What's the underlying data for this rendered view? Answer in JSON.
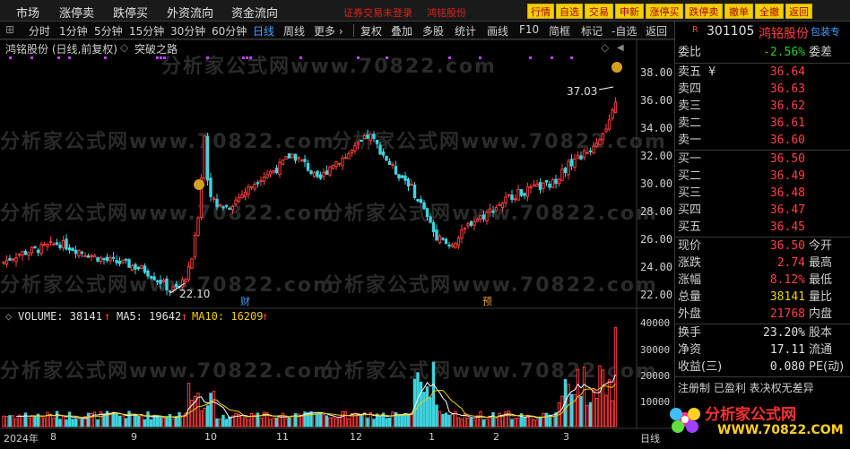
{
  "menu": {
    "items": [
      "市场",
      "涨停卖",
      "跌停买",
      "外资流向",
      "资金流向"
    ],
    "warning": "证券交易未登录",
    "stock_name": "鸿铭股份",
    "quick": [
      "行情",
      "自选",
      "交易",
      "申新",
      "涨停买",
      "跌停卖",
      "撤单",
      "全撤",
      "返回"
    ]
  },
  "toolbar": {
    "periods": [
      "分时",
      "1分钟",
      "5分钟",
      "15分钟",
      "30分钟",
      "60分钟",
      "日线",
      "周线",
      "更多 ›"
    ],
    "active_period": "日线",
    "tools": [
      "复权",
      "叠加",
      "多股",
      "统计",
      "画线",
      "F10",
      "简框",
      "标记",
      "-自选",
      "返回"
    ]
  },
  "chart_title": {
    "name": "鸿铭股份 (日线,前复权)",
    "indicator": "突破之路"
  },
  "price_axis": [
    "38.00",
    "36.00",
    "34.00",
    "32.00",
    "30.00",
    "28.00",
    "26.00",
    "24.00",
    "22.00"
  ],
  "annotations": {
    "high_label": "37.03",
    "low_label": "22.10",
    "fin_marker": "财",
    "fore_marker": "预"
  },
  "volume_legend": {
    "volume": "VOLUME: 38141",
    "ma5": "MA5: 19642",
    "ma10": "MA10: 16209",
    "arrow": "↑"
  },
  "volume_axis": [
    "40000",
    "30000",
    "20000",
    "10000"
  ],
  "time_axis": [
    "2024年",
    "8",
    "9",
    "10",
    "11",
    "12",
    "1",
    "2",
    "3"
  ],
  "bottom_tab": "日线",
  "panel": {
    "code": "301105",
    "name": "鸿铭股份",
    "badge": "包装专",
    "r_marker": "R",
    "weibi_label": "委比",
    "weibi_value": "-2.56%",
    "weicha_label": "委差",
    "asks": [
      {
        "label": "卖五",
        "extra": "¥",
        "price": "36.64"
      },
      {
        "label": "卖四",
        "extra": "",
        "price": "36.63"
      },
      {
        "label": "卖三",
        "extra": "",
        "price": "36.62"
      },
      {
        "label": "卖二",
        "extra": "",
        "price": "36.61"
      },
      {
        "label": "卖一",
        "extra": "",
        "price": "36.60"
      }
    ],
    "bids": [
      {
        "label": "买一",
        "price": "36.50"
      },
      {
        "label": "买二",
        "price": "36.49"
      },
      {
        "label": "买三",
        "price": "36.48"
      },
      {
        "label": "买四",
        "price": "36.47"
      },
      {
        "label": "买五",
        "price": "36.45"
      }
    ],
    "stats": [
      {
        "label": "现价",
        "value": "36.50",
        "color": "red",
        "label2": "今开"
      },
      {
        "label": "涨跌",
        "value": "2.74",
        "color": "red",
        "label2": "最高"
      },
      {
        "label": "涨幅",
        "value": "8.12%",
        "color": "red",
        "label2": "最低"
      },
      {
        "label": "总量",
        "value": "38141",
        "color": "yellow",
        "label2": "量比"
      },
      {
        "label": "外盘",
        "value": "21768",
        "color": "red",
        "label2": "内盘"
      },
      {
        "label": "换手",
        "value": "23.20%",
        "color": "white",
        "label2": "股本"
      },
      {
        "label": "净资",
        "value": "17.11",
        "color": "white",
        "label2": "流通"
      },
      {
        "label": "收益(三)",
        "value": "0.080",
        "color": "white",
        "label2": "PE(动)"
      }
    ],
    "footer": "注册制 已盈利 表决权无差异"
  },
  "watermark": "分析家公式网www.70822.com",
  "logo": {
    "text": "分析家公式网",
    "url": "WWW.70822.COM"
  },
  "colors": {
    "up": "#ff3c3c",
    "down": "#3fd4e0",
    "ma5": "#ffffff",
    "ma10": "#f0d000",
    "purple": "#c040ff"
  }
}
